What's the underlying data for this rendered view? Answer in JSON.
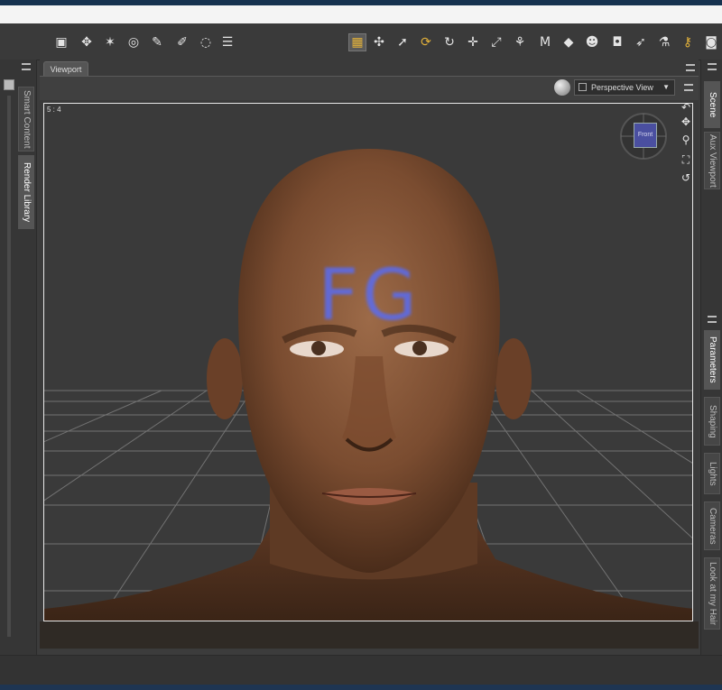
{
  "toolbar": {
    "icons_left": [
      "camera-cube-icon",
      "universal-arrows-icon",
      "sparkle-wand-icon",
      "target-icon",
      "dropper-icon",
      "eraser-icon",
      "dashed-circle-icon",
      "bars-icon"
    ],
    "icons_right": [
      "grid-select-icon",
      "move-universal-icon",
      "pointer-icon",
      "gold-rotate-icon",
      "rotate-icon",
      "translate-icon",
      "scale-icon",
      "joint-editor-icon",
      "morph-icon",
      "surface-icon",
      "figure-icon",
      "camera-icon",
      "node-pointer-icon",
      "geometry-icon",
      "gold-lock-icon",
      "camera-small-icon"
    ]
  },
  "left_tabs": [
    "Smart Content",
    "Render Library"
  ],
  "right_tabs": [
    "Scene",
    "Aux Viewport",
    "Parameters",
    "Shaping",
    "Lights",
    "Cameras",
    "Look at my Hair"
  ],
  "viewport": {
    "tab_label": "Viewport",
    "view_select": "Perspective View",
    "aspect_ratio": "5 : 4",
    "cube_face": "Front",
    "forehead_text": "FG"
  },
  "colors": {
    "accent_gold": "#e2b13a",
    "cube_blue": "#4a4fa0",
    "forehead_blue": "#5a6cf0",
    "skin": "#8a5a3a"
  }
}
